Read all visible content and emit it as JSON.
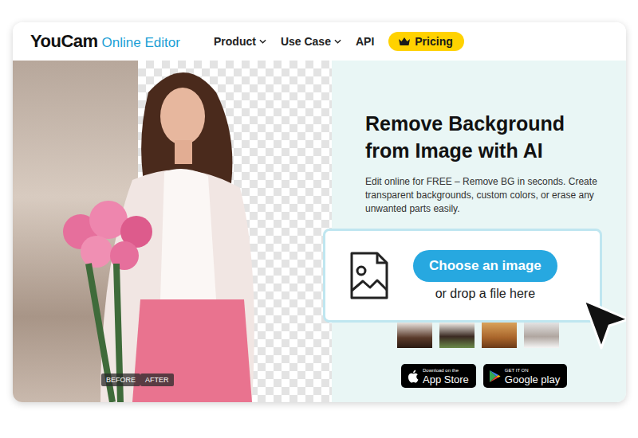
{
  "logo": {
    "brand": "YouCam",
    "product": "Online Editor"
  },
  "nav": [
    {
      "label": "Product",
      "dropdown": true
    },
    {
      "label": "Use Case",
      "dropdown": true
    },
    {
      "label": "API",
      "dropdown": false
    }
  ],
  "pricing": {
    "label": "Pricing"
  },
  "hero": {
    "before_label": "BEFORE",
    "after_label": "AFTER"
  },
  "title_lines": [
    "Remove Background",
    "from Image with AI"
  ],
  "description": "Edit online for FREE – Remove BG in seconds. Create transparent backgrounds, custom colors, or erase any unwanted parts easily.",
  "upload": {
    "button": "Choose an image",
    "hint": "or drop a file here"
  },
  "stores": [
    {
      "small": "Download on the",
      "name": "App Store",
      "kind": "apple"
    },
    {
      "small": "GET IT ON",
      "name": "Google play",
      "kind": "google"
    }
  ]
}
